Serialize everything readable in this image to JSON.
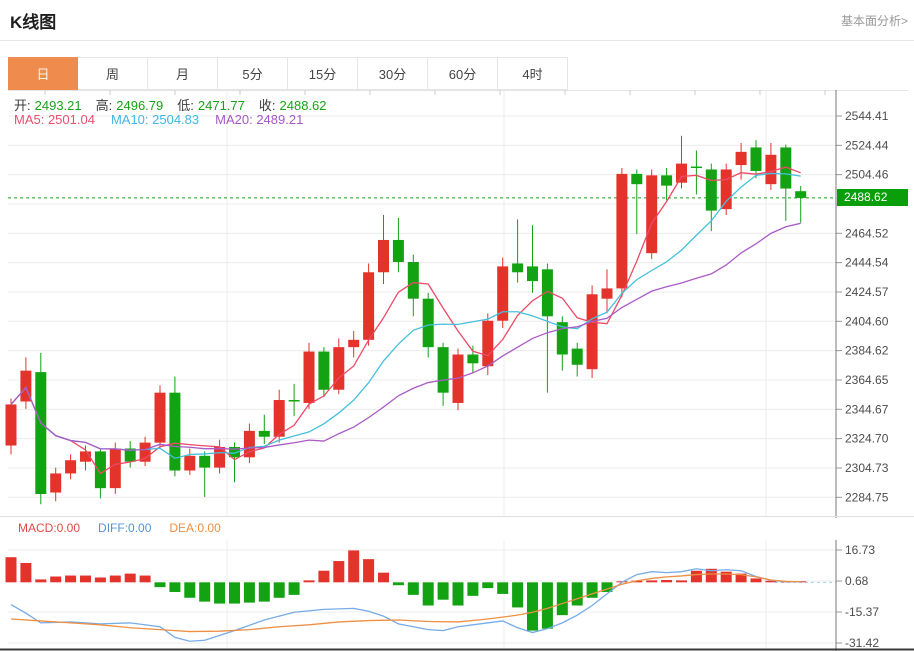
{
  "header": {
    "title": "K线图",
    "link_label": "基本面分析>"
  },
  "tabs": {
    "items": [
      "日",
      "周",
      "月",
      "5分",
      "15分",
      "30分",
      "60分",
      "4时"
    ],
    "active_index": 0
  },
  "ohlc_legend": {
    "open_label": "开:",
    "open_value": "2493.21",
    "high_label": "高:",
    "high_value": "2496.79",
    "low_label": "低:",
    "low_value": "2471.77",
    "close_label": "收:",
    "close_value": "2488.62"
  },
  "ma_legend": {
    "ma5": "MA5: 2501.04",
    "ma10": "MA10: 2504.83",
    "ma20": "MA20: 2489.21"
  },
  "macd_legend": {
    "macd": "MACD:0.00",
    "diff": "DIFF:0.00",
    "dea": "DEA:0.00"
  },
  "price_badge": "2488.62",
  "colors": {
    "up": "#e4332b",
    "down": "#12a212",
    "ma5": "#ed4a67",
    "ma10": "#45c0dd",
    "ma20": "#ab5bc6",
    "diff_line": "#76ace6",
    "dea_line": "#ee8f44",
    "badge_bg": "#0a9e0a",
    "active_tab": "#ef8b4c",
    "price_line": "#15a015",
    "grid": "#ececec",
    "axis": "#7a7a7a",
    "tick_text": "#4d4d4d"
  },
  "chart_data": [
    {
      "type": "candlestick",
      "title": "K线图 (日)",
      "legend_position": "top-left",
      "grid": true,
      "y_axis_side": "right",
      "ylim": [
        2271,
        2564
      ],
      "y_ticks": [
        "2544.41",
        "2524.44",
        "2504.46",
        "",
        "2464.52",
        "2444.54",
        "2424.57",
        "2404.60",
        "2384.62",
        "2364.65",
        "2344.67",
        "2324.70",
        "2304.73",
        "2284.75"
      ],
      "y_tick_values": [
        2544.41,
        2524.44,
        2504.46,
        2484.49,
        2464.52,
        2444.54,
        2424.57,
        2404.6,
        2384.62,
        2364.65,
        2344.67,
        2324.7,
        2304.73,
        2284.75
      ],
      "current_price": 2488.62,
      "ma_periods": [
        5,
        10,
        20
      ],
      "candles_format": [
        "open",
        "close",
        "high",
        "low"
      ],
      "candles": [
        [
          2320,
          2348,
          2352,
          2314
        ],
        [
          2350,
          2371,
          2380,
          2345
        ],
        [
          2370,
          2287,
          2383,
          2280
        ],
        [
          2288,
          2301,
          2305,
          2282
        ],
        [
          2301,
          2310,
          2314,
          2297
        ],
        [
          2309,
          2316,
          2320,
          2303
        ],
        [
          2316,
          2291,
          2318,
          2284
        ],
        [
          2291,
          2318,
          2322,
          2287
        ],
        [
          2318,
          2309,
          2323,
          2305
        ],
        [
          2309,
          2322,
          2326,
          2306
        ],
        [
          2322,
          2356,
          2361,
          2318
        ],
        [
          2356,
          2303,
          2367,
          2299
        ],
        [
          2303,
          2313,
          2318,
          2300
        ],
        [
          2313,
          2305,
          2316,
          2285
        ],
        [
          2305,
          2319,
          2324,
          2301
        ],
        [
          2319,
          2312,
          2322,
          2295
        ],
        [
          2312,
          2330,
          2335,
          2308
        ],
        [
          2330,
          2326,
          2341,
          2321
        ],
        [
          2326,
          2351,
          2358,
          2322
        ],
        [
          2351,
          2350,
          2362,
          2340
        ],
        [
          2349,
          2384,
          2390,
          2345
        ],
        [
          2384,
          2358,
          2387,
          2353
        ],
        [
          2358,
          2387,
          2393,
          2355
        ],
        [
          2387,
          2392,
          2398,
          2380
        ],
        [
          2392,
          2438,
          2444,
          2388
        ],
        [
          2438,
          2460,
          2477,
          2430
        ],
        [
          2460,
          2445,
          2475,
          2438
        ],
        [
          2445,
          2420,
          2450,
          2408
        ],
        [
          2420,
          2387,
          2424,
          2380
        ],
        [
          2387,
          2356,
          2390,
          2347
        ],
        [
          2349,
          2382,
          2386,
          2344
        ],
        [
          2382,
          2376,
          2388,
          2369
        ],
        [
          2374,
          2405,
          2410,
          2368
        ],
        [
          2405,
          2442,
          2448,
          2400
        ],
        [
          2444,
          2438,
          2474,
          2431
        ],
        [
          2442,
          2432,
          2470,
          2424
        ],
        [
          2440,
          2408,
          2444,
          2356
        ],
        [
          2404,
          2382,
          2408,
          2371
        ],
        [
          2386,
          2375,
          2390,
          2367
        ],
        [
          2372,
          2423,
          2429,
          2366
        ],
        [
          2420,
          2427,
          2440,
          2410
        ],
        [
          2427,
          2505,
          2509,
          2421
        ],
        [
          2505,
          2498,
          2508,
          2464
        ],
        [
          2451,
          2504,
          2508,
          2447
        ],
        [
          2504,
          2497,
          2509,
          2487
        ],
        [
          2499,
          2512,
          2531,
          2495
        ],
        [
          2510,
          2509,
          2521,
          2491
        ],
        [
          2508,
          2480,
          2512,
          2466
        ],
        [
          2481,
          2508,
          2512,
          2477
        ],
        [
          2511,
          2520,
          2526,
          2501
        ],
        [
          2523,
          2507,
          2528,
          2502
        ],
        [
          2498,
          2518,
          2526,
          2494
        ],
        [
          2523,
          2495,
          2525,
          2473
        ],
        [
          2493.21,
          2488.62,
          2496.79,
          2471.77
        ]
      ]
    },
    {
      "type": "bar",
      "title": "MACD",
      "y_ticks": [
        16.73,
        0.68,
        -15.37,
        -31.42
      ],
      "histogram": [
        13,
        10,
        1.5,
        3,
        3.5,
        3.5,
        2.5,
        3.5,
        4.5,
        3.5,
        -2.5,
        -5,
        -8,
        -10,
        -11,
        -11,
        -10.5,
        -10,
        -8,
        -6.5,
        1,
        6,
        11,
        16.5,
        12,
        5,
        -1.5,
        -6.5,
        -12,
        -9,
        -12,
        -7,
        -3,
        -6,
        -13,
        -25,
        -24,
        -17,
        -12,
        -8,
        -5,
        0.5,
        0.8,
        1,
        1.2,
        1,
        6,
        7,
        5.5,
        4.5,
        2,
        0.8,
        0.4,
        0.2
      ],
      "series": [
        {
          "name": "DIFF",
          "points": [
            [
              0,
              -11.5
            ],
            [
              1,
              -16
            ],
            [
              2,
              -21
            ],
            [
              4,
              -20.5
            ],
            [
              6,
              -21.5
            ],
            [
              8,
              -21
            ],
            [
              10,
              -23
            ],
            [
              11,
              -28.5
            ],
            [
              12,
              -30.5
            ],
            [
              13,
              -30
            ],
            [
              15,
              -25
            ],
            [
              17,
              -19.5
            ],
            [
              19,
              -15.5
            ],
            [
              21,
              -14
            ],
            [
              23,
              -13.5
            ],
            [
              24,
              -15
            ],
            [
              25,
              -17.5
            ],
            [
              26,
              -21.5
            ],
            [
              28,
              -24.5
            ],
            [
              29,
              -25
            ],
            [
              30,
              -23
            ],
            [
              31,
              -22
            ],
            [
              33,
              -20
            ],
            [
              34,
              -23.5
            ],
            [
              35,
              -26
            ],
            [
              36,
              -24
            ],
            [
              37,
              -21
            ],
            [
              38,
              -17
            ],
            [
              39,
              -12
            ],
            [
              40,
              -6
            ],
            [
              41,
              0
            ],
            [
              42,
              4
            ],
            [
              43,
              5.5
            ],
            [
              44,
              5
            ],
            [
              45,
              5.5
            ],
            [
              46,
              7
            ],
            [
              47,
              6
            ],
            [
              48,
              6.5
            ],
            [
              49,
              6
            ],
            [
              50,
              3
            ],
            [
              51,
              1
            ],
            [
              52,
              0.4
            ],
            [
              53,
              0.3
            ]
          ]
        },
        {
          "name": "DEA",
          "points": [
            [
              0,
              -19
            ],
            [
              2,
              -20
            ],
            [
              4,
              -21
            ],
            [
              6,
              -22
            ],
            [
              8,
              -23.5
            ],
            [
              10,
              -24.5
            ],
            [
              12,
              -25.5
            ],
            [
              14,
              -25.3
            ],
            [
              16,
              -24.5
            ],
            [
              18,
              -23
            ],
            [
              20,
              -22
            ],
            [
              22,
              -20.5
            ],
            [
              24,
              -19.8
            ],
            [
              26,
              -19.5
            ],
            [
              28,
              -20.3
            ],
            [
              30,
              -20.5
            ],
            [
              32,
              -19
            ],
            [
              34,
              -17
            ],
            [
              35,
              -15.5
            ],
            [
              36,
              -13.5
            ],
            [
              37,
              -11
            ],
            [
              38,
              -8.5
            ],
            [
              39,
              -6
            ],
            [
              40,
              -3.5
            ],
            [
              41,
              -1
            ],
            [
              42,
              0.8
            ],
            [
              43,
              2
            ],
            [
              44,
              2.8
            ],
            [
              45,
              3.3
            ],
            [
              46,
              4
            ],
            [
              47,
              4.3
            ],
            [
              48,
              4.3
            ],
            [
              49,
              4
            ],
            [
              50,
              2.8
            ],
            [
              51,
              1.2
            ],
            [
              52,
              0.5
            ],
            [
              53,
              0.3
            ]
          ]
        }
      ]
    }
  ]
}
